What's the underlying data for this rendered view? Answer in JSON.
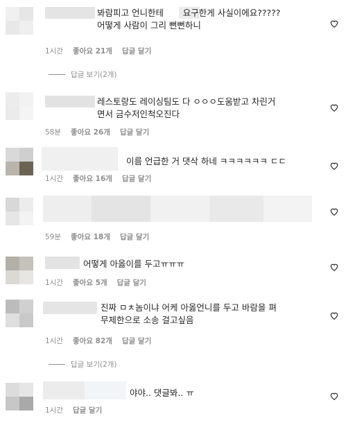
{
  "comments": [
    {
      "text": "봐람피고 언니한테       요구한게 사실이에요?????\n어떻게 사람이 그리 뻔뻔하니",
      "time": "1시간",
      "likes": "좋아요 21개",
      "reply": "답글 달기"
    },
    {
      "text": "레스토랑도 레이싱팀도 다 ㅇㅇㅇ도움받고 차린거\n면서 금수저인척오진다",
      "time": "58분",
      "likes": "좋아요 26개",
      "reply": "답글 달기"
    },
    {
      "text": "이름 언급한 거 댓삭 하네 ㅋㅋㅋㅋㅋㅋ ㄷㄷ",
      "time": "1시간",
      "likes": "좋아요 16개",
      "reply": "답글 달기"
    },
    {
      "text": "",
      "time": "59분",
      "likes": "좋아요 18개",
      "reply": "답글 달기"
    },
    {
      "text": "어떻게 아옳이를 두고ㅠㅠㅠ",
      "time": "1시간",
      "likes": "좋아요 5개",
      "reply": "답글 달기"
    },
    {
      "text": "진짜 ㅁㅊ놈이냐 어케 아옳언니를 두고 바람을 펴\n무제한으로 소송 걸고싶음",
      "time": "1시간",
      "likes": "좋아요 82개",
      "reply": "답글 달기"
    },
    {
      "text": "야야.. 댓글봐.. ㅠ",
      "time": "1시간",
      "likes": "",
      "reply": "답글 달기"
    }
  ],
  "view_replies": [
    "답글 보기(2개)",
    "답글 보기(2개)"
  ],
  "colors": {
    "meta": "#8e8e8e",
    "text": "#262626"
  }
}
